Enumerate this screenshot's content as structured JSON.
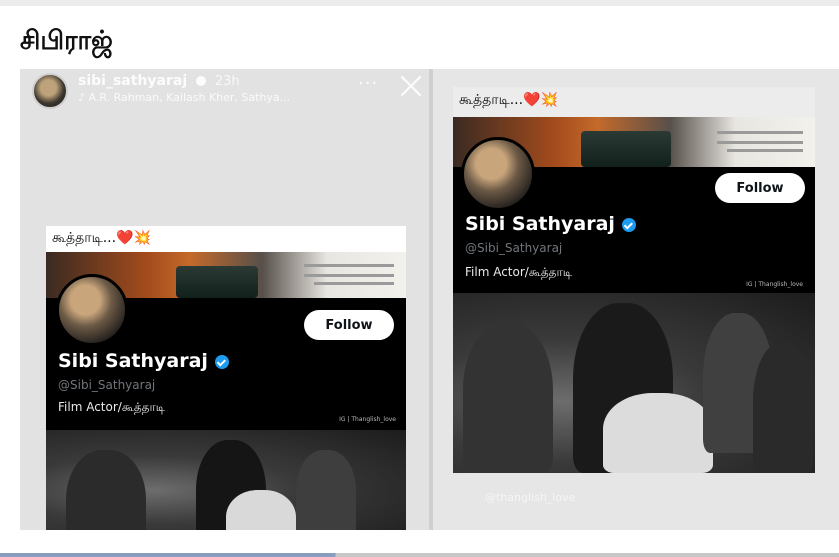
{
  "heading": "சிபிராஜ்",
  "story": {
    "username": "sibi_sathyaraj",
    "time": "23h",
    "music": "A.R. Rahman, Kailash Kher, Sathya...",
    "more_symbol": "···"
  },
  "profile_card": {
    "caption": "கூத்தாடி...❤️💥",
    "name": "Sibi Sathyaraj",
    "handle": "@Sibi_Sathyaraj",
    "bio": "Film Actor/கூத்தாடி",
    "follow_label": "Follow",
    "watermark": "IG | Thanglish_love"
  },
  "post": {
    "tag": "@thanglish_love"
  },
  "colors": {
    "verified_blue": "#1d9bf0",
    "profile_bg": "#000000",
    "follow_bg": "#ffffff"
  },
  "icons": [
    "more-icon",
    "close-icon",
    "verified-icon",
    "music-icon"
  ]
}
